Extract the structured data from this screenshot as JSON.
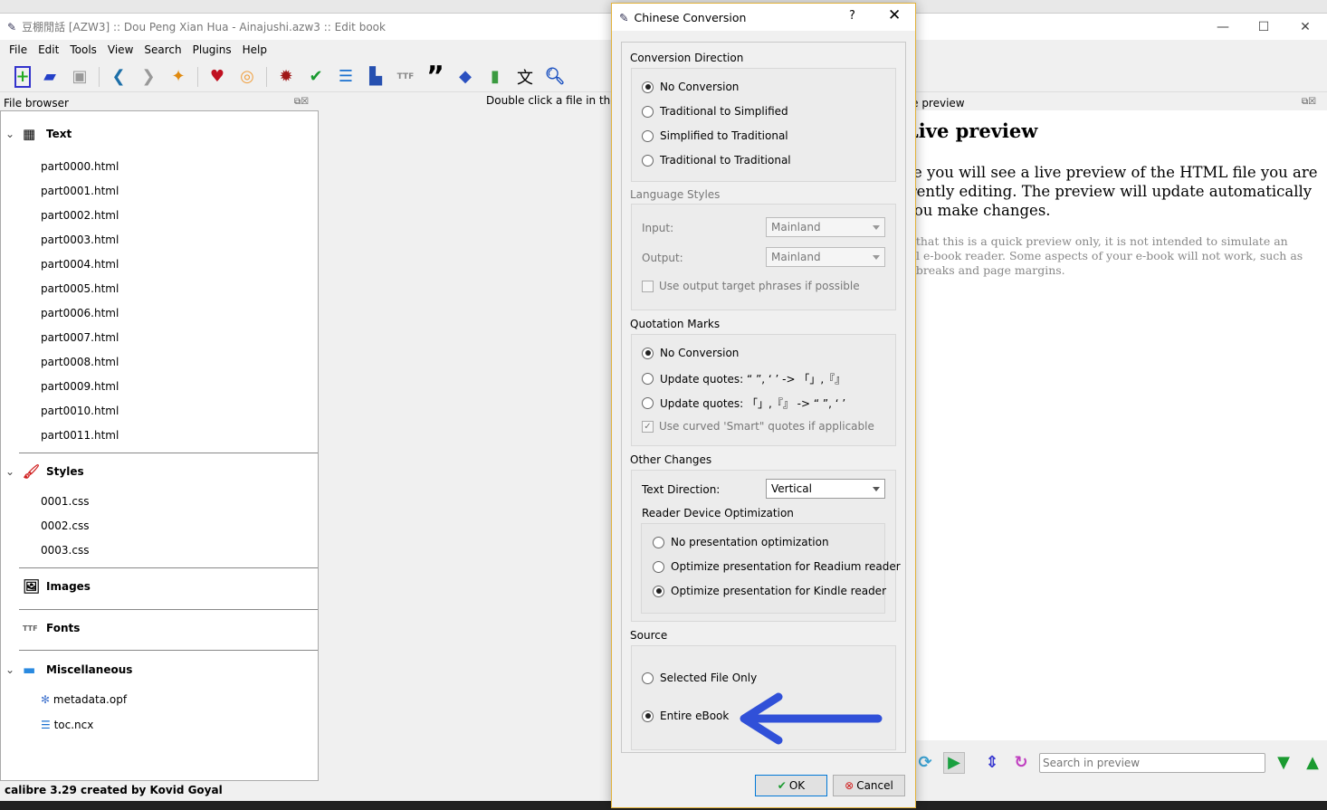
{
  "window": {
    "title": "豆棚閒話 [AZW3] :: Dou Peng Xian Hua - Ainajushi.azw3 :: Edit book"
  },
  "menu": [
    "File",
    "Edit",
    "Tools",
    "View",
    "Search",
    "Plugins",
    "Help"
  ],
  "toolbar": [
    "new-file-icon",
    "open-book-icon",
    "save-icon",
    "back-icon",
    "forward-icon",
    "checkpoint-pin-icon",
    "donate-heart-icon",
    "help-lifebuoy-icon",
    "check-book-bug-icon",
    "spell-check-icon",
    "table-of-contents-icon",
    "dictionary-icon",
    "embed-fonts-icon",
    "smarten-quotes-icon",
    "remove-formatting-icon",
    "reports-icon",
    "chinese-conversion-icon",
    "search-icon"
  ],
  "file_browser": {
    "title": "File browser",
    "categories": {
      "text": {
        "label": "Text",
        "files": [
          "part0000.html",
          "part0001.html",
          "part0002.html",
          "part0003.html",
          "part0004.html",
          "part0005.html",
          "part0006.html",
          "part0007.html",
          "part0008.html",
          "part0009.html",
          "part0010.html",
          "part0011.html"
        ]
      },
      "styles": {
        "label": "Styles",
        "files": [
          "0001.css",
          "0002.css",
          "0003.css"
        ]
      },
      "images": {
        "label": "Images"
      },
      "fonts": {
        "label": "Fonts"
      },
      "misc": {
        "label": "Miscellaneous",
        "files": [
          "metadata.opf",
          "toc.ncx"
        ]
      }
    }
  },
  "editor": {
    "hint": "Double click a file in the left"
  },
  "preview": {
    "dock_title": "Live preview",
    "heading": "Live preview",
    "main_text": "Here you will see a live preview of the HTML file you are currently editing. The preview will update automatically as you make changes.",
    "note": "Note that this is a quick preview only, it is not intended to simulate an actual e-book reader. Some aspects of your e-book will not work, such as page breaks and page margins.",
    "search_placeholder": "Search in preview"
  },
  "status": "calibre 3.29 created by Kovid Goyal",
  "dialog": {
    "title": "Chinese Conversion",
    "help": "?",
    "direction": {
      "title": "Conversion Direction",
      "options": [
        "No Conversion",
        "Traditional to Simplified",
        "Simplified to Traditional",
        "Traditional to Traditional"
      ],
      "selected": 0
    },
    "language": {
      "title": "Language Styles",
      "input_label": "Input:",
      "input_value": "Mainland",
      "output_label": "Output:",
      "output_value": "Mainland",
      "phrases_label": "Use output target phrases if possible",
      "phrases_checked": false
    },
    "quotes": {
      "title": "Quotation Marks",
      "options": [
        "No Conversion",
        "Update quotes: “ ”, ‘ ’ -> 「」,『』",
        "Update quotes: 「」,『』 -> “ ”, ‘ ’"
      ],
      "selected": 0,
      "smart_label": "Use curved 'Smart\" quotes if applicable",
      "smart_checked": true
    },
    "other": {
      "title": "Other Changes",
      "direction_label": "Text Direction:",
      "direction_value": "Vertical",
      "reader_title": "Reader Device Optimization",
      "reader_options": [
        "No presentation optimization",
        "Optimize presentation for Readium reader",
        "Optimize presentation for Kindle reader"
      ],
      "reader_selected": 2
    },
    "source": {
      "title": "Source",
      "options": [
        "Selected File Only",
        "Entire eBook"
      ],
      "selected": 1
    },
    "ok": "OK",
    "cancel": "Cancel"
  },
  "colors": {
    "dialog_border": "#e1b23b",
    "arrow": "#3050d8"
  }
}
